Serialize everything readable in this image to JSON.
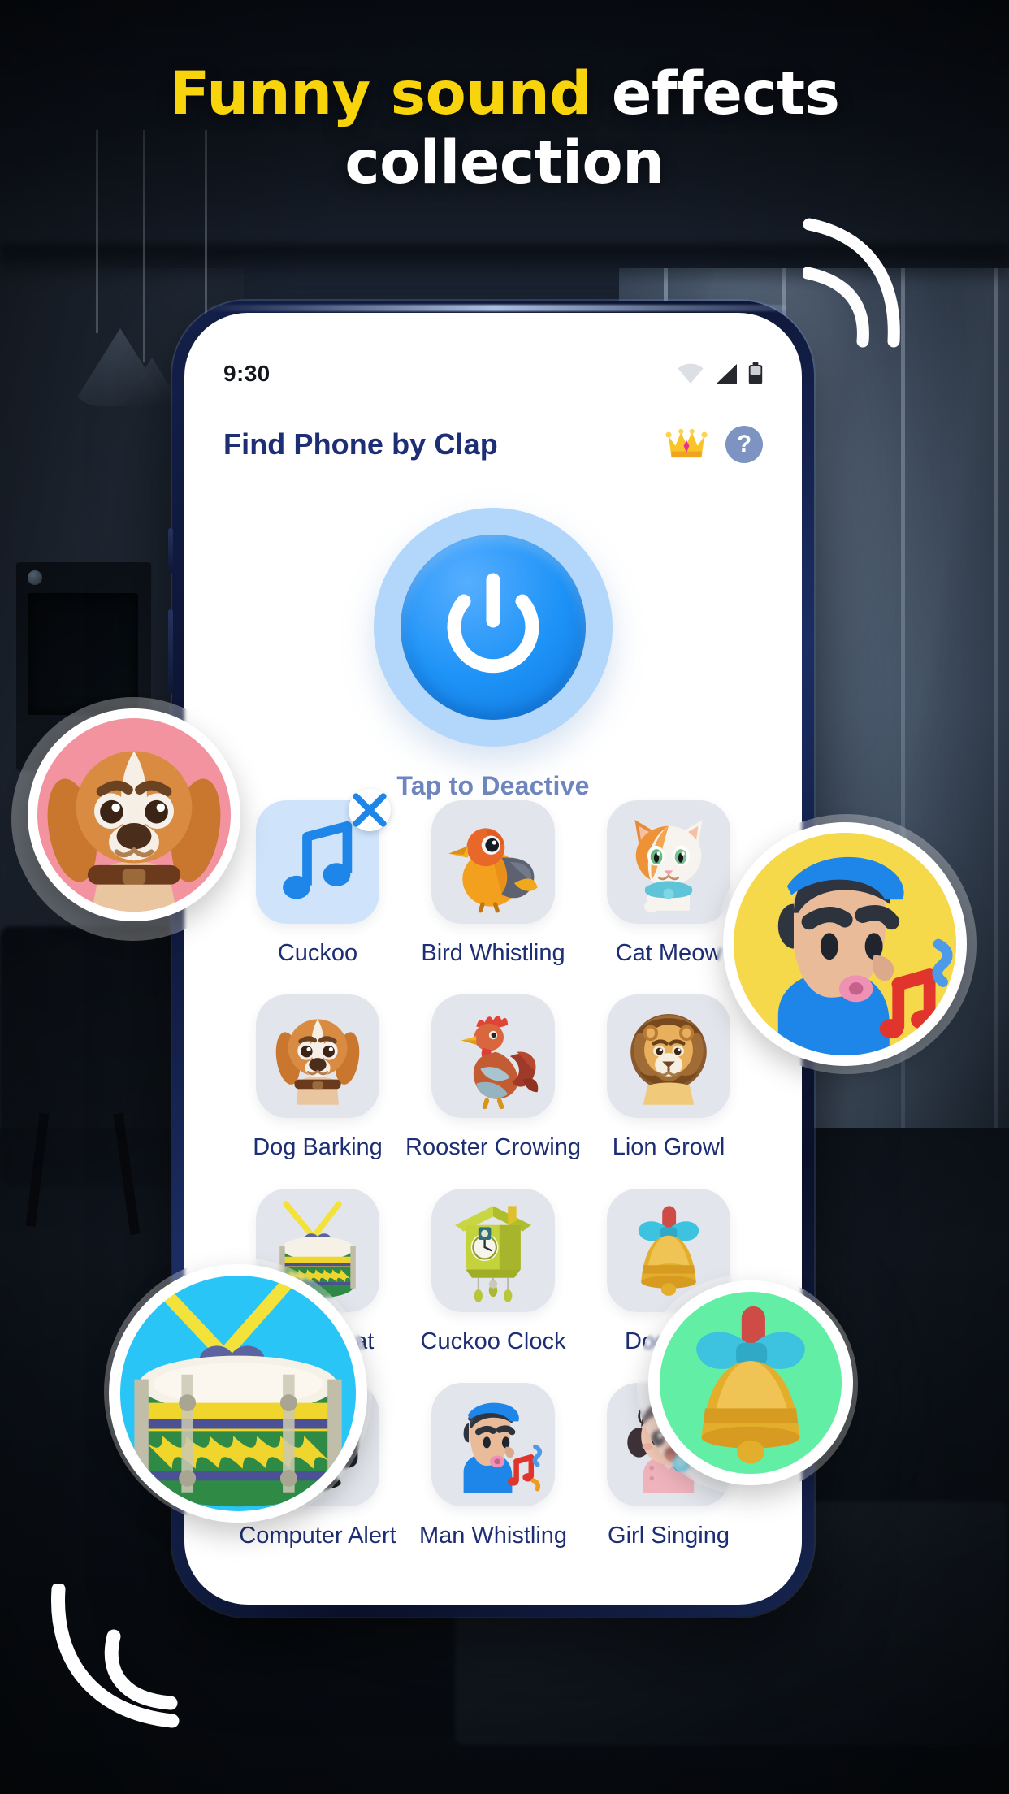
{
  "promo": {
    "headline_line1_highlight": "Funny sound",
    "headline_line1_rest": " effects",
    "headline_line2": "collection",
    "highlight_color": "#F7D40B",
    "text_color": "#FFFFFF"
  },
  "phone": {
    "status_bar": {
      "time": "9:30",
      "icons": [
        "wifi-icon",
        "cellular-signal-icon",
        "battery-icon"
      ]
    },
    "app_bar": {
      "title": "Find Phone by Clap",
      "premium_icon": "crown-icon",
      "help_label": "?"
    },
    "power": {
      "icon": "power-icon",
      "label": "Tap to Deactive",
      "ring_color": "#B3D7FB",
      "core_color": "#1E93F7",
      "label_color": "#6F85BE",
      "state": "active"
    },
    "sounds": {
      "selected_badge": "close-icon",
      "items": [
        {
          "label": "Cuckoo",
          "icon": "music-note-icon",
          "selected": true
        },
        {
          "label": "Bird Whistling",
          "icon": "bird-icon",
          "selected": false
        },
        {
          "label": "Cat Meow",
          "icon": "cat-icon",
          "selected": false
        },
        {
          "label": "Dog Barking",
          "icon": "dog-icon",
          "selected": false
        },
        {
          "label": "Rooster Crowing",
          "icon": "rooster-icon",
          "selected": false
        },
        {
          "label": "Lion Growl",
          "icon": "lion-icon",
          "selected": false
        },
        {
          "label": "Drum Beat",
          "icon": "drum-icon",
          "selected": false
        },
        {
          "label": "Cuckoo Clock",
          "icon": "cuckoo-clock-icon",
          "selected": false
        },
        {
          "label": "Doorbell",
          "icon": "doorbell-icon",
          "selected": false
        },
        {
          "label": "Computer Alert",
          "icon": "monitor-icon",
          "selected": false
        },
        {
          "label": "Man Whistling",
          "icon": "whistling-man-icon",
          "selected": false
        },
        {
          "label": "Girl Singing",
          "icon": "girl-singing-icon",
          "selected": false
        }
      ]
    }
  },
  "overlay_bubbles": [
    {
      "name": "dog-bubble",
      "icon": "dog-icon",
      "bg": "#F2939F"
    },
    {
      "name": "whistling-man-bubble",
      "icon": "whistling-man-icon",
      "bg": "#F6D84B"
    },
    {
      "name": "drum-bubble",
      "icon": "drum-icon",
      "bg": "#29C5F6"
    },
    {
      "name": "doorbell-bubble",
      "icon": "doorbell-icon",
      "bg": "#62EFA5"
    }
  ],
  "decorations": [
    {
      "name": "sound-wave-arcs-top-right"
    },
    {
      "name": "sound-wave-arcs-bottom-left"
    }
  ]
}
